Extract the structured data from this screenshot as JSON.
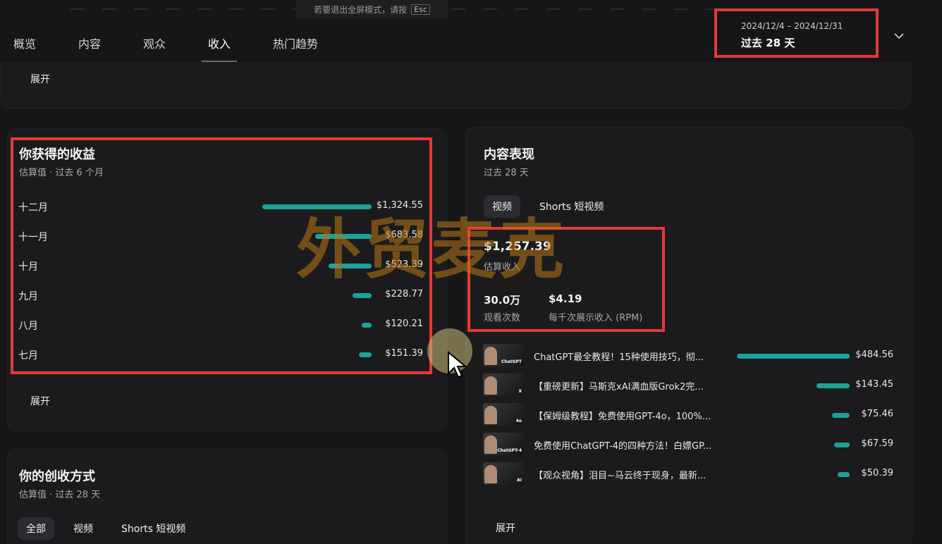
{
  "top_notice": {
    "text": "若要退出全屏模式，请按",
    "key": "Esc"
  },
  "tabs": [
    {
      "label": "概览"
    },
    {
      "label": "内容"
    },
    {
      "label": "观众"
    },
    {
      "label": "收入",
      "active": true
    },
    {
      "label": "热门趋势"
    }
  ],
  "date_picker": {
    "range": "2024/12/4 – 2024/12/31",
    "label": "过去 28 天"
  },
  "top_card": {
    "expand_label": "展开"
  },
  "revenue_card": {
    "title": "你获得的收益",
    "subtitle": "估算值 · 过去 6 个月",
    "expand_label": "展开",
    "rows": [
      {
        "month": "十二月",
        "value": "$1,324.55",
        "amount": 1324.55
      },
      {
        "month": "十一月",
        "value": "$683.58",
        "amount": 683.58
      },
      {
        "month": "十月",
        "value": "$523.39",
        "amount": 523.39
      },
      {
        "month": "九月",
        "value": "$228.77",
        "amount": 228.77
      },
      {
        "month": "八月",
        "value": "$120.21",
        "amount": 120.21
      },
      {
        "month": "七月",
        "value": "$151.39",
        "amount": 151.39
      }
    ]
  },
  "performance_card": {
    "title": "内容表现",
    "subtitle": "过去 28 天",
    "chips": [
      {
        "label": "视频",
        "active": true
      },
      {
        "label": "Shorts 短视频",
        "active": false
      }
    ],
    "estimated_revenue": {
      "value": "$1,257.39",
      "label": "估算收入"
    },
    "views": {
      "value": "30.0万",
      "label": "观看次数"
    },
    "rpm": {
      "value": "$4.19",
      "label": "每千次展示收入 (RPM)"
    },
    "expand_label": "展开",
    "videos": [
      {
        "title": "ChatGPT最全教程！15种使用技巧，彻...",
        "value": "$484.56",
        "amount": 484.56,
        "thumb_text": "ChatGPT"
      },
      {
        "title": "【重磅更新】马斯克xAI满血版Grok2完...",
        "value": "$143.45",
        "amount": 143.45,
        "thumb_text": "X"
      },
      {
        "title": "【保姆级教程】免费使用GPT-4o，100%...",
        "value": "$75.46",
        "amount": 75.46,
        "thumb_text": "4o"
      },
      {
        "title": "免费使用ChatGPT-4的四种方法！白嫖GP...",
        "value": "$67.59",
        "amount": 67.59,
        "thumb_text": "ChatGPT-4"
      },
      {
        "title": "【观众视角】泪目~马云终于现身，最新...",
        "value": "$50.39",
        "amount": 50.39,
        "thumb_text": "AI"
      }
    ]
  },
  "monetization_card": {
    "title": "你的创收方式",
    "subtitle": "估算值 · 过去 28 天",
    "chips": [
      {
        "label": "全部",
        "active": true
      },
      {
        "label": "视频",
        "active": false
      },
      {
        "label": "Shorts 短视频",
        "active": false
      }
    ]
  },
  "watermark": "外贸麦克",
  "colors": {
    "accent_bar": "#1aa39a",
    "annotation": "#e53935",
    "background": "#161618"
  }
}
